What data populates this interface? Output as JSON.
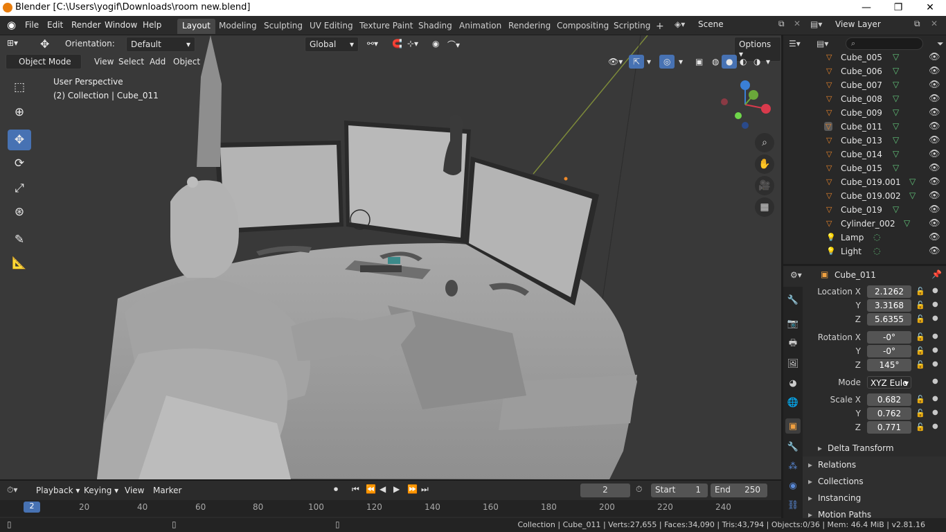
{
  "window": {
    "title": "Blender [C:\\Users\\yogif\\Downloads\\room new.blend]",
    "controls": [
      "—",
      "❐",
      "✕"
    ]
  },
  "menu": [
    "File",
    "Edit",
    "Render",
    "Window",
    "Help"
  ],
  "workspaces": {
    "tabs": [
      "Layout",
      "Modeling",
      "Sculpting",
      "UV Editing",
      "Texture Paint",
      "Shading",
      "Animation",
      "Rendering",
      "Compositing",
      "Scripting"
    ],
    "active": "Layout",
    "add": "+"
  },
  "scene": {
    "name": "Scene"
  },
  "view_layer": {
    "name": "View Layer"
  },
  "tool_header": {
    "orientation_label": "Orientation:",
    "orientation_value": "Default",
    "transform_orientation": "Global",
    "options": "Options"
  },
  "viewport_header": {
    "mode": "Object Mode",
    "menus": [
      "View",
      "Select",
      "Add",
      "Object"
    ]
  },
  "viewport": {
    "perspective": "User Perspective",
    "collection_info": "(2) Collection | Cube_011"
  },
  "outliner": {
    "search_placeholder": "",
    "items": [
      {
        "name": "Cube_005",
        "type": "mesh"
      },
      {
        "name": "Cube_006",
        "type": "mesh"
      },
      {
        "name": "Cube_007",
        "type": "mesh"
      },
      {
        "name": "Cube_008",
        "type": "mesh"
      },
      {
        "name": "Cube_009",
        "type": "mesh"
      },
      {
        "name": "Cube_011",
        "type": "mesh",
        "selected": true
      },
      {
        "name": "Cube_013",
        "type": "mesh"
      },
      {
        "name": "Cube_014",
        "type": "mesh"
      },
      {
        "name": "Cube_015",
        "type": "mesh"
      },
      {
        "name": "Cube_019.001",
        "type": "mesh"
      },
      {
        "name": "Cube_019.002",
        "type": "mesh"
      },
      {
        "name": "Cube_019",
        "type": "mesh"
      },
      {
        "name": "Cylinder_002",
        "type": "mesh"
      },
      {
        "name": "Lamp",
        "type": "light"
      },
      {
        "name": "Light",
        "type": "light"
      }
    ]
  },
  "properties": {
    "object_name": "Cube_011",
    "location": {
      "label": "Location X",
      "x": "2.1262",
      "y": "3.3168",
      "z": "5.6355"
    },
    "rotation": {
      "label": "Rotation X",
      "x": "-0°",
      "y": "-0°",
      "z": "145°"
    },
    "mode": {
      "label": "Mode",
      "value": "XYZ Eule"
    },
    "scale": {
      "label": "Scale X",
      "x": "0.682",
      "y": "0.762",
      "z": "0.771"
    },
    "axis_y": "Y",
    "axis_z": "Z",
    "sections": [
      "Delta Transform",
      "Relations",
      "Collections",
      "Instancing",
      "Motion Paths"
    ]
  },
  "timeline": {
    "menus": [
      "Playback",
      "Keying",
      "View",
      "Marker"
    ],
    "current_frame": "2",
    "start_label": "Start",
    "start": "1",
    "end_label": "End",
    "end": "250",
    "ruler": [
      "20",
      "40",
      "60",
      "80",
      "100",
      "120",
      "140",
      "160",
      "180",
      "200",
      "220",
      "240"
    ],
    "playhead": "2"
  },
  "statusbar": {
    "stats": "Collection | Cube_011 | Verts:27,655 | Faces:34,090 | Tris:43,794 | Objects:0/36 | Mem: 46.4 MiB | v2.81.16"
  },
  "colors": {
    "accent": "#4772b3",
    "mesh_icon": "#e8842a",
    "data_icon": "#62c47a",
    "viewport_bg": "#393939"
  }
}
